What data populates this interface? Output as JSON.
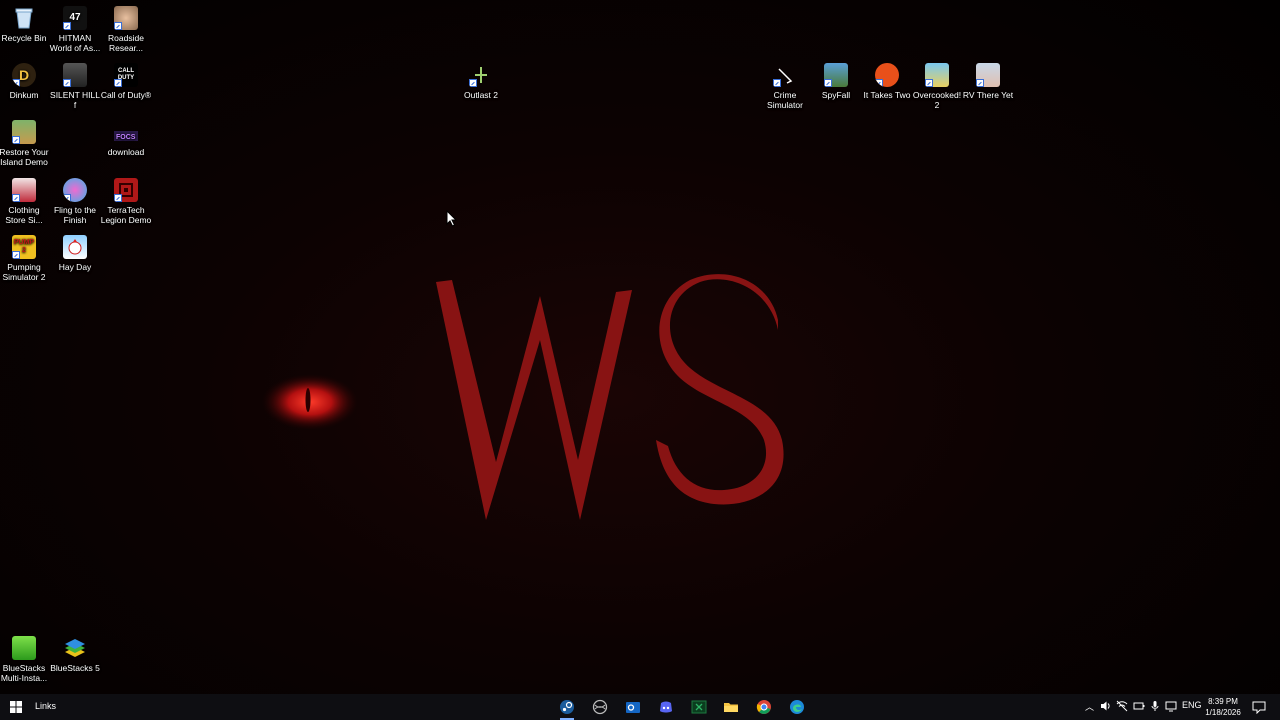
{
  "desktop": {
    "icons": [
      {
        "label": "Recycle Bin"
      },
      {
        "label": "HITMAN World of As..."
      },
      {
        "label": "Roadside Resear..."
      },
      {
        "label": "Dinkum"
      },
      {
        "label": "SILENT HILL f"
      },
      {
        "label": "Call of Duty®"
      },
      {
        "label": "Restore Your Island Demo"
      },
      {
        "label": "download"
      },
      {
        "label": "Clothing Store Si..."
      },
      {
        "label": "Fling to the Finish"
      },
      {
        "label": "TerraTech Legion Demo"
      },
      {
        "label": "Pumping Simulator 2"
      },
      {
        "label": "Hay Day"
      },
      {
        "label": "BlueStacks Multi-Insta..."
      },
      {
        "label": "BlueStacks 5"
      },
      {
        "label": "Outlast 2"
      },
      {
        "label": "Crime Simulator"
      },
      {
        "label": "SpyFall"
      },
      {
        "label": "It Takes Two"
      },
      {
        "label": "Overcooked! 2"
      },
      {
        "label": "RV There Yet"
      }
    ],
    "icon_glyphs": {
      "hitman": "47",
      "dinkum": "D",
      "cod": "CALL DUTY",
      "pumping": "PUMP 2"
    }
  },
  "taskbar": {
    "links_label": "Links",
    "apps": [
      "steam",
      "chrome-dino",
      "outlook",
      "discord",
      "excel",
      "file-explorer",
      "chrome",
      "edge"
    ],
    "tray": {
      "language": "ENG",
      "time": "8:39 PM",
      "date": "1/18/2026"
    }
  },
  "colors": {
    "wallpaper_red": "#8e1414",
    "taskbar_bg": "#0e0e12"
  }
}
